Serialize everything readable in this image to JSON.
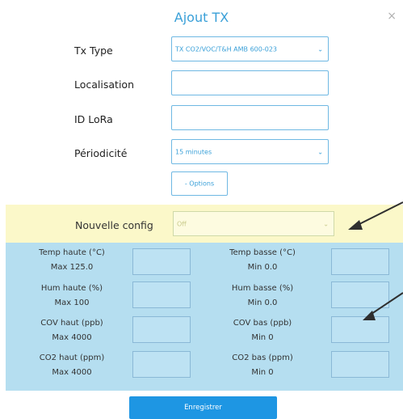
{
  "dialog": {
    "title": "Ajout TX",
    "close_glyph": "×"
  },
  "form": {
    "tx_type": {
      "label": "Tx Type",
      "value": "TX CO2/VOC/T&H AMB 600-023"
    },
    "localisation": {
      "label": "Localisation",
      "value": ""
    },
    "id_lora": {
      "label": "ID LoRa",
      "value": ""
    },
    "periodicite": {
      "label": "Périodicité",
      "value": "15 minutes"
    },
    "options_label": "- Options"
  },
  "nouvelle_config": {
    "label": "Nouvelle config",
    "value": "Off"
  },
  "thresholds": [
    {
      "name": "Temp haute (°C)",
      "limit": "Max 125.0",
      "value": ""
    },
    {
      "name": "Temp basse (°C)",
      "limit": "Min 0.0",
      "value": ""
    },
    {
      "name": "Hum haute (%)",
      "limit": "Max 100",
      "value": ""
    },
    {
      "name": "Hum basse (%)",
      "limit": "Min 0.0",
      "value": ""
    },
    {
      "name": "COV haut (ppb)",
      "limit": "Max 4000",
      "value": ""
    },
    {
      "name": "COV bas (ppb)",
      "limit": "Min 0",
      "value": ""
    },
    {
      "name": "CO2 haut (ppm)",
      "limit": "Max 4000",
      "value": ""
    },
    {
      "name": "CO2 bas (ppm)",
      "limit": "Min 0",
      "value": ""
    }
  ],
  "save_label": "Enregistrer",
  "icons": {
    "close": "close-icon",
    "select_chevron": "chevron-down-icon",
    "annotation_arrow": "arrow-icon"
  },
  "colors": {
    "accent": "#3aa0d8",
    "highlight_yellow": "#fbf8c9",
    "highlight_blue": "#b5def0",
    "save_button": "#1e96e3"
  }
}
